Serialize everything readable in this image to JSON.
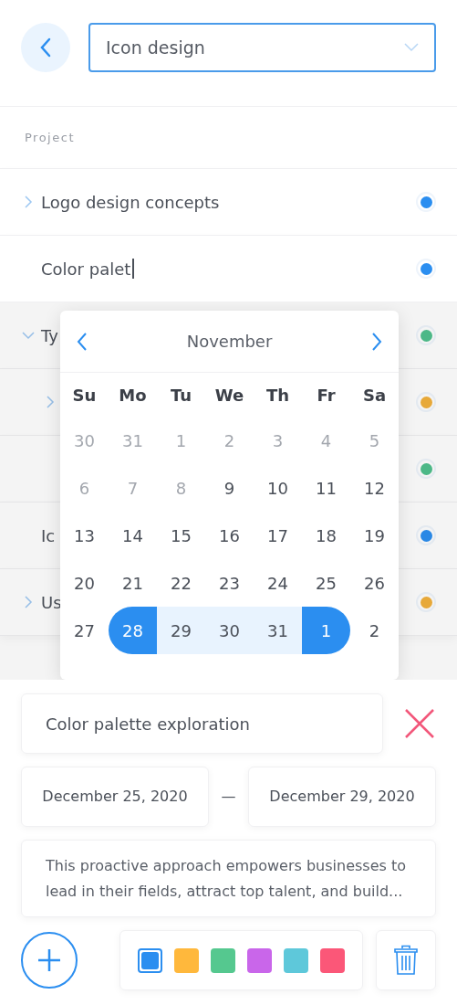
{
  "header": {
    "project_select": {
      "value": "Icon design"
    }
  },
  "section_label": "Project",
  "rows": [
    {
      "label": "Logo design concepts",
      "color": "#2b8ef0",
      "expanded": false
    },
    {
      "label": "Color palet",
      "color": "#2b8ef0",
      "editing": true
    },
    {
      "label": "Ty",
      "color": "#4fc08d",
      "expanded": true,
      "children": [
        {
          "color": "#f2b03c",
          "expanded": false
        },
        {
          "color": "#4fc08d"
        }
      ]
    },
    {
      "label": "Ic",
      "color": "#2b8ef0"
    },
    {
      "label": "Us",
      "color": "#f2b03c",
      "expanded": false
    }
  ],
  "calendar": {
    "month": "November",
    "weekdays": [
      "Su",
      "Mo",
      "Tu",
      "We",
      "Th",
      "Fr",
      "Sa"
    ],
    "weeks": [
      [
        {
          "day": "30",
          "muted": true
        },
        {
          "day": "31",
          "muted": true
        },
        {
          "day": "1",
          "muted": true
        },
        {
          "day": "2",
          "muted": true
        },
        {
          "day": "3",
          "muted": true
        },
        {
          "day": "4",
          "muted": true
        },
        {
          "day": "5",
          "muted": true
        }
      ],
      [
        {
          "day": "6",
          "muted": true
        },
        {
          "day": "7",
          "muted": true
        },
        {
          "day": "8",
          "muted": true
        },
        {
          "day": "9",
          "muted": false
        },
        {
          "day": "10",
          "muted": false
        },
        {
          "day": "11",
          "muted": false
        },
        {
          "day": "12",
          "muted": false
        }
      ],
      [
        {
          "day": "13",
          "muted": false
        },
        {
          "day": "14",
          "muted": false
        },
        {
          "day": "15",
          "muted": false
        },
        {
          "day": "16",
          "muted": false
        },
        {
          "day": "17",
          "muted": false
        },
        {
          "day": "18",
          "muted": false
        },
        {
          "day": "19",
          "muted": false
        }
      ],
      [
        {
          "day": "20",
          "muted": false
        },
        {
          "day": "21",
          "muted": false
        },
        {
          "day": "22",
          "muted": false
        },
        {
          "day": "23",
          "muted": false
        },
        {
          "day": "24",
          "muted": false
        },
        {
          "day": "25",
          "muted": false
        },
        {
          "day": "26",
          "muted": false
        }
      ],
      [
        {
          "day": "27",
          "muted": false
        },
        {
          "day": "28",
          "muted": false,
          "selected": true
        },
        {
          "day": "29",
          "muted": false,
          "in_range": true
        },
        {
          "day": "30",
          "muted": false,
          "in_range": true
        },
        {
          "day": "31",
          "muted": false,
          "in_range": true
        },
        {
          "day": "1",
          "muted": false,
          "selected": true
        },
        {
          "day": "2",
          "muted": false
        }
      ]
    ]
  },
  "editor": {
    "name": "Color palette exploration",
    "start_date": "December 25, 2020",
    "end_date": "December 29, 2020",
    "separator": "—",
    "description": "This proactive approach empowers businesses to lead in their fields, attract top talent, and build...",
    "colors": [
      {
        "color": "#2b8ef0",
        "selected": true
      },
      {
        "color": "#ffb83c",
        "selected": false
      },
      {
        "color": "#55c88f",
        "selected": false
      },
      {
        "color": "#c966ea",
        "selected": false
      },
      {
        "color": "#5ec8da",
        "selected": false
      },
      {
        "color": "#fb5778",
        "selected": false
      }
    ]
  }
}
